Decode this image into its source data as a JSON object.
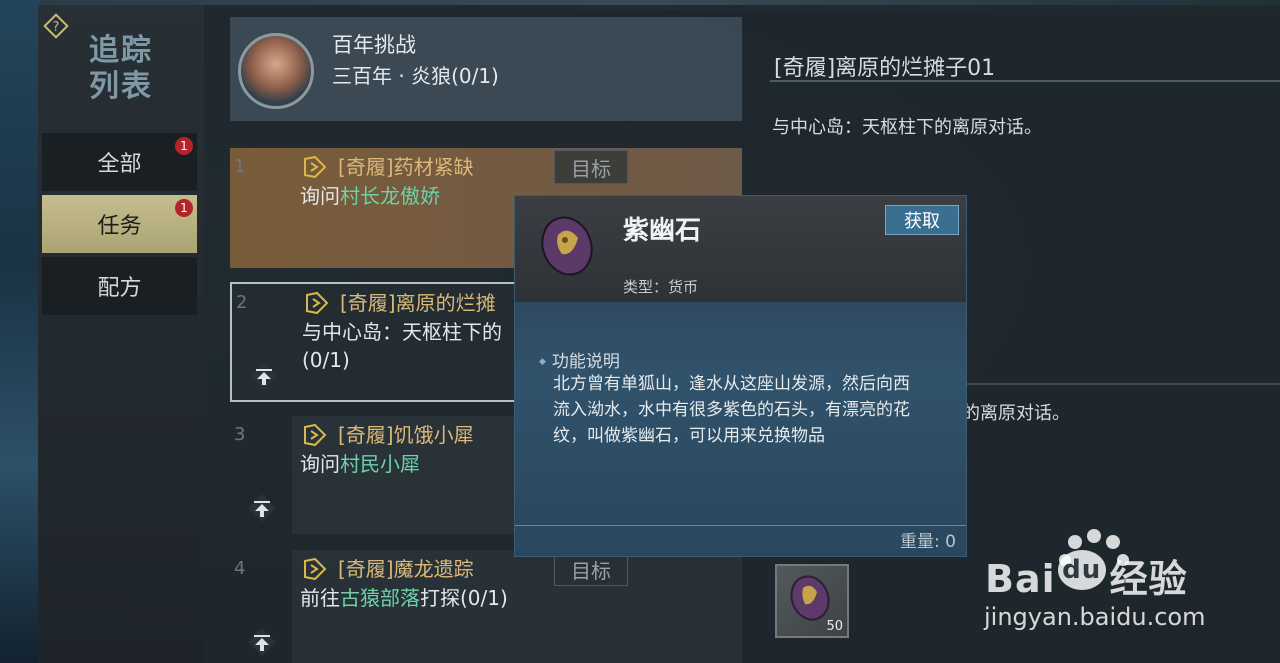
{
  "sidebar": {
    "title_lines": [
      "追踪",
      "列表"
    ],
    "tabs": [
      {
        "label": "全部",
        "badge": "1"
      },
      {
        "label": "任务",
        "badge": "1"
      },
      {
        "label": "配方"
      }
    ]
  },
  "header": {
    "title": "百年挑战",
    "subtitle": "三百年 · 炎狼(0/1)"
  },
  "quests": [
    {
      "num": "1",
      "title": "[奇履]药材紧缺",
      "desc_prefix": "询问",
      "desc_highlight": "村长龙傲娇",
      "desc_suffix": "",
      "target_label": "目标"
    },
    {
      "num": "2",
      "title": "[奇履]离原的烂摊",
      "desc_line1": "与中心岛：天枢柱下的",
      "desc_line2": "(0/1)"
    },
    {
      "num": "3",
      "title": "[奇履]饥饿小犀",
      "desc_prefix": "询问",
      "desc_highlight": "村民小犀",
      "desc_suffix": ""
    },
    {
      "num": "4",
      "title": "[奇履]魔龙遗踪",
      "desc_prefix": "前往",
      "desc_highlight": "古猿部落",
      "desc_suffix": "打探(0/1)",
      "target_label": "目标"
    }
  ],
  "detail": {
    "title": "[奇履]离原的烂摊子01",
    "desc": "与中心岛：天枢柱下的离原对话。",
    "desc_partial": "的离原对话。",
    "reward_count": "50"
  },
  "popup": {
    "item_name": "紫幽石",
    "get_label": "获取",
    "type_text": "类型：货币",
    "section_title": "功能说明",
    "body": "北方曾有单狐山，逢水从这座山发源，然后向西流入泑水，水中有很多紫色的石头，有漂亮的花纹，叫做紫幽石，可以用来兑换物品",
    "weight": "重量: 0"
  },
  "watermark": {
    "brand": "Bai",
    "brand_suffix": "经验",
    "url": "jingyan.baidu.com"
  },
  "colors": {
    "quest_title": "#d9b878",
    "highlight": "#6fd0a8",
    "active_tab": "#c5bd8e",
    "badge": "#b3242a",
    "get_button": "#3b6f91"
  },
  "icons": [
    "help-icon",
    "quest-arrow-icon",
    "pin-top-icon",
    "purple-stone-icon",
    "baidu-paw-icon"
  ]
}
